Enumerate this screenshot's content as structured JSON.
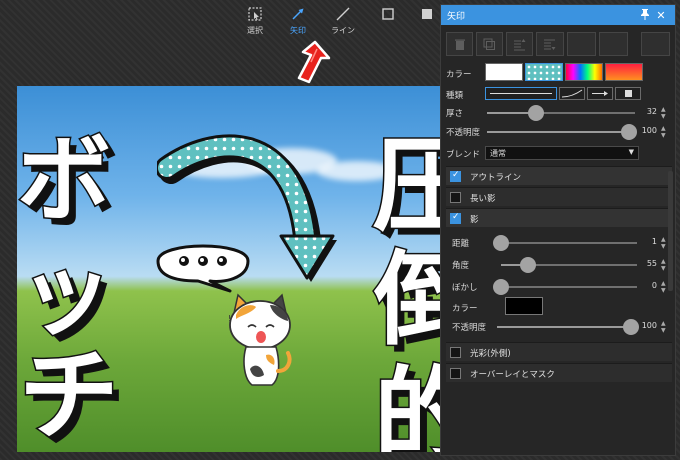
{
  "toolbar": {
    "tools": [
      {
        "label": "選択",
        "icon": "selection-icon"
      },
      {
        "label": "矢印",
        "icon": "arrow-icon"
      },
      {
        "label": "ライン",
        "icon": "line-icon"
      },
      {
        "label": "",
        "icon": "rectangle-icon"
      },
      {
        "label": "",
        "icon": "filled-rectangle-icon"
      }
    ],
    "active": "矢印"
  },
  "canvas": {
    "left_text": "ボッチ",
    "right_text": "圧倒的",
    "bubble": "speech-bubble-with-dots",
    "sticker": "calico-cat"
  },
  "panel": {
    "title": "矢印",
    "pin_icon": "pin-icon",
    "close_icon": "close-icon",
    "color_label": "カラー",
    "type_label": "種類",
    "thickness_label": "厚さ",
    "thickness_value": 32,
    "opacity_label": "不透明度",
    "opacity_value": 100,
    "blend_label": "ブレンド",
    "blend_value": "通常",
    "sections": {
      "outline": {
        "label": "アウトライン",
        "checked": true
      },
      "long_shadow": {
        "label": "長い影",
        "checked": false
      },
      "shadow": {
        "label": "影",
        "checked": true
      },
      "glow": {
        "label": "光彩(外側)",
        "checked": false
      },
      "overlay": {
        "label": "オーバーレイとマスク",
        "checked": false
      }
    },
    "shadow": {
      "distance_label": "距離",
      "distance_value": 1,
      "angle_label": "角度",
      "angle_value": 55,
      "blur_label": "ぼかし",
      "blur_value": 0,
      "color_label": "カラー",
      "color": "#000000",
      "opacity_label": "不透明度",
      "opacity_value": 100
    }
  },
  "colors": {
    "accent": "#3b93e0",
    "arrow_fill": "#5fc0c0",
    "annotation_arrow": "#e8231e"
  }
}
